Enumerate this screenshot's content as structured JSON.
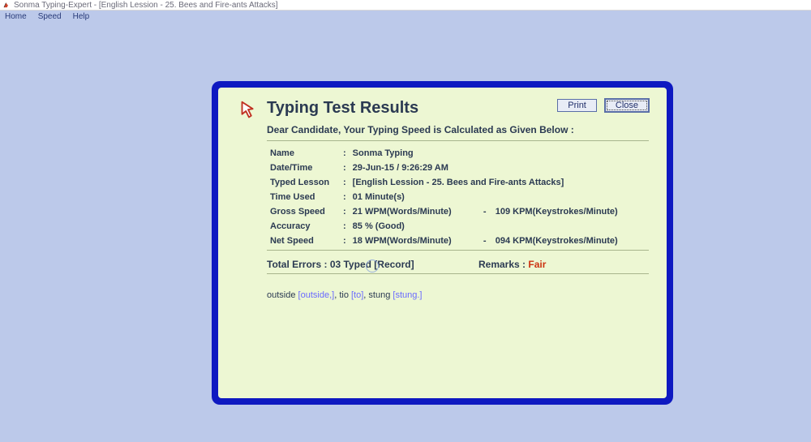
{
  "window": {
    "title": "Sonma Typing-Expert - [English Lession - 25. Bees and Fire-ants Attacks]"
  },
  "menu": {
    "items": [
      "Home",
      "Speed",
      "Help"
    ]
  },
  "dialog": {
    "title": "Typing Test Results",
    "subtitle": "Dear Candidate, Your Typing Speed is Calculated as Given Below :",
    "buttons": {
      "print": "Print",
      "close": "Close"
    },
    "rows": {
      "name": {
        "label": "Name",
        "value": "Sonma Typing"
      },
      "datetime": {
        "label": "Date/Time",
        "value": "29-Jun-15 / 9:26:29 AM"
      },
      "lesson": {
        "label": "Typed Lesson",
        "value": "[English Lession - 25. Bees and Fire-ants Attacks]"
      },
      "timeused": {
        "label": "Time Used",
        "value": "01 Minute(s)"
      },
      "gross": {
        "label": "Gross Speed",
        "wpm": "21 WPM(Words/Minute)",
        "kpm": "109 KPM(Keystrokes/Minute)"
      },
      "accuracy": {
        "label": "Accuracy",
        "value": "85 % (Good)"
      },
      "net": {
        "label": "Net Speed",
        "wpm": "18 WPM(Words/Minute)",
        "kpm": "094 KPM(Keystrokes/Minute)"
      }
    },
    "summary": {
      "errors_label": "Total Errors  :",
      "errors_value": "03 Typed [Record]",
      "remarks_label": "Remarks  :",
      "remarks_value": "Fair"
    },
    "error_words": [
      {
        "typed": "outside",
        "expected": "[outside,]"
      },
      {
        "typed": "tio",
        "expected": "[to]"
      },
      {
        "typed": "stung",
        "expected": "[stung.]"
      }
    ],
    "dash": "-"
  }
}
